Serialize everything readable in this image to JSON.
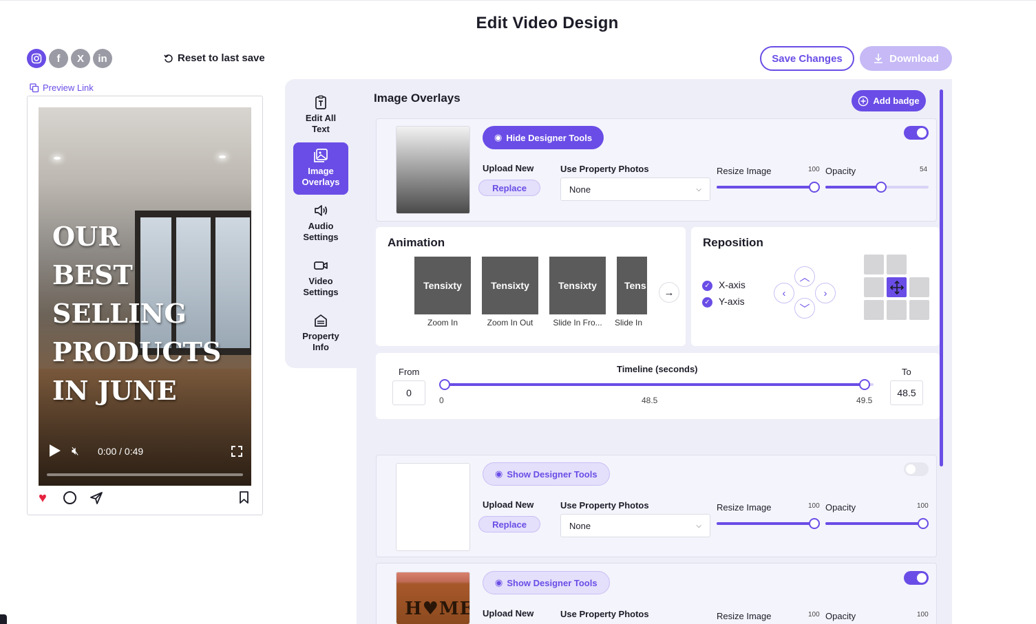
{
  "page": {
    "title": "Edit Video Design"
  },
  "social": {
    "instagram": "ig",
    "facebook": "f",
    "x": "X",
    "linkedin": "in"
  },
  "toolbar": {
    "reset_label": "Reset to last save",
    "save_label": "Save Changes",
    "download_label": "Download"
  },
  "preview": {
    "link_label": "Preview Link",
    "headline_lines": [
      "OUR",
      "BEST SELLING",
      "PRODUCTS",
      "IN JUNE"
    ],
    "time": "0:00 / 0:49"
  },
  "side_menu": {
    "items": [
      {
        "line1": "Edit All",
        "line2": "Text"
      },
      {
        "line1": "Image",
        "line2": "Overlays"
      },
      {
        "line1": "Audio",
        "line2": "Settings"
      },
      {
        "line1": "Video",
        "line2": "Settings"
      },
      {
        "line1": "Property",
        "line2": "Info"
      }
    ]
  },
  "overlays": {
    "section_title": "Image Overlays",
    "add_badge_label": "Add badge",
    "upload_label": "Upload New",
    "replace_label": "Replace",
    "property_photos_label": "Use Property Photos",
    "select_value": "None",
    "resize_label": "Resize Image",
    "opacity_label": "Opacity",
    "cards": [
      {
        "designer_label": "Hide Designer Tools",
        "enabled": true,
        "resize": 100,
        "opacity": 54
      },
      {
        "designer_label": "Show Designer Tools",
        "enabled": false,
        "resize": 100,
        "opacity": 100
      },
      {
        "designer_label": "Show Designer Tools",
        "enabled": true,
        "resize": 100,
        "opacity": 100
      }
    ],
    "third_thumb_text": "H♥ME"
  },
  "animation": {
    "title": "Animation",
    "tiles": [
      {
        "text": "Tensixty",
        "caption": "Zoom In"
      },
      {
        "text": "Tensixty",
        "caption": "Zoom In Out"
      },
      {
        "text": "Tensixty",
        "caption": "Slide In Fro..."
      },
      {
        "text": "Tens",
        "caption": "Slide In"
      }
    ]
  },
  "reposition": {
    "title": "Reposition",
    "x_axis": "X-axis",
    "y_axis": "Y-axis"
  },
  "timeline": {
    "from_label": "From",
    "to_label": "To",
    "title": "Timeline (seconds)",
    "from_value": "0",
    "to_value": "48.5",
    "min_label": "0",
    "mid_label": "48.5",
    "max_label": "49.5",
    "start": 0,
    "end": 48.5,
    "max": 49.5
  },
  "colors": {
    "accent": "#6a4de6",
    "accent_light": "#e4dffb",
    "panel": "#eeeef8",
    "heart": "#e6213d"
  }
}
